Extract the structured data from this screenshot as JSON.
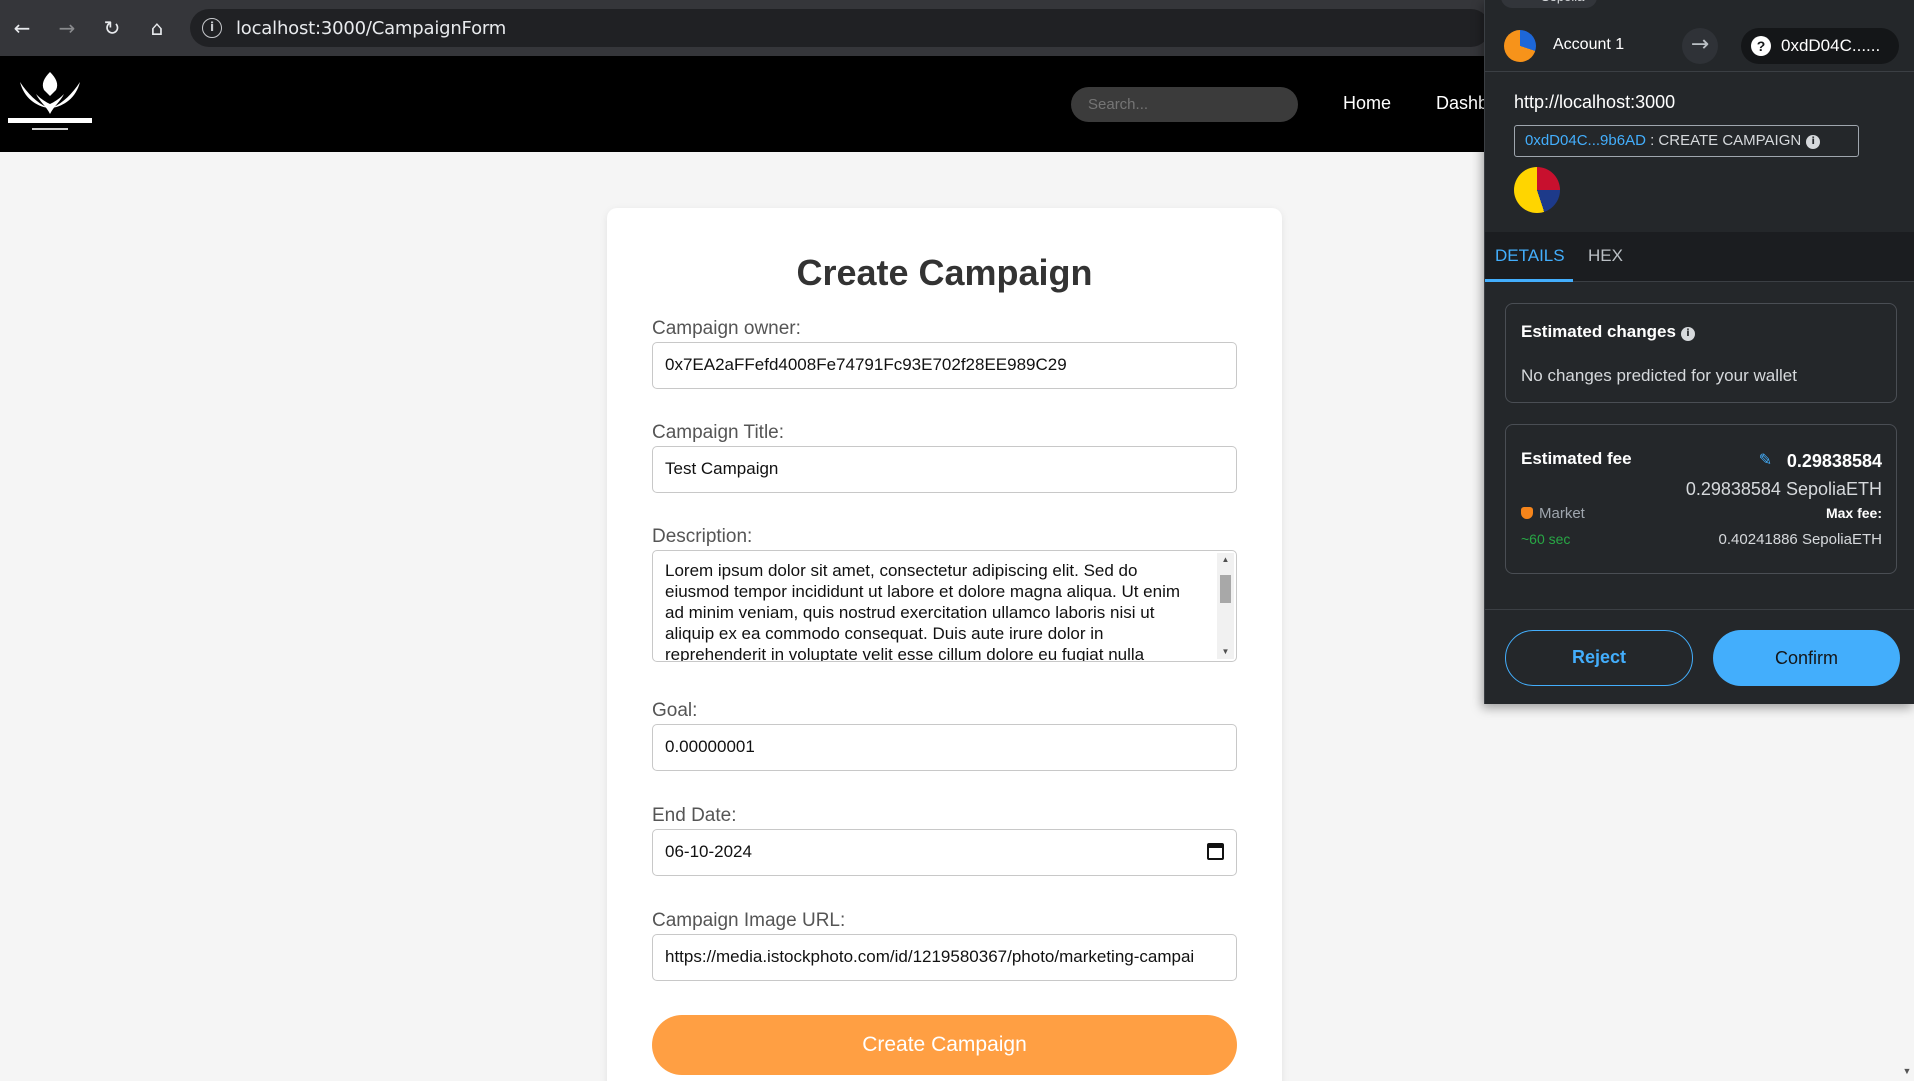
{
  "browser": {
    "url": "localhost:3000/CampaignForm",
    "back_icon": "arrow-left-icon",
    "forward_icon": "arrow-right-icon",
    "reload_icon": "reload-icon",
    "home_icon": "home-icon"
  },
  "site": {
    "logo_icon": "crowdfunding-logo-icon",
    "search_placeholder": "Search...",
    "nav": [
      "Home",
      "Dashb"
    ]
  },
  "form": {
    "title": "Create Campaign",
    "owner_label": "Campaign owner:",
    "owner_value": "0x7EA2aFFefd4008Fe74791Fc93E702f28EE989C29",
    "title_label": "Campaign Title:",
    "title_value": "Test Campaign",
    "description_label": "Description:",
    "description_value": "Lorem ipsum dolor sit amet, consectetur adipiscing elit. Sed do eiusmod tempor incididunt ut labore et dolore magna aliqua. Ut enim ad minim veniam, quis nostrud exercitation ullamco laboris nisi ut aliquip ex ea commodo consequat. Duis aute irure dolor in reprehenderit in voluptate velit esse cillum dolore eu fugiat nulla",
    "goal_label": "Goal:",
    "goal_value": "0.00000001",
    "end_date_label": "End Date:",
    "end_date_value": "06-10-2024",
    "image_label": "Campaign Image URL:",
    "image_value": "https://media.istockphoto.com/id/1219580367/photo/marketing-campai",
    "submit_label": "Create Campaign",
    "accent_color": "#ff9f43"
  },
  "metamask": {
    "network": "Sepolia",
    "account_name": "Account 1",
    "destination": "0xdD04C......",
    "origin": "http://localhost:3000",
    "contract_address": "0xdD04C...9b6AD",
    "separator": " : ",
    "method": "CREATE CAMPAIGN",
    "tabs": [
      "DETAILS",
      "HEX"
    ],
    "active_tab": "DETAILS",
    "estimated_changes_title": "Estimated changes",
    "estimated_changes_text": "No changes predicted for your wallet",
    "estimated_fee_title": "Estimated fee",
    "fee_amount": "0.29838584",
    "fee_eth": "0.29838584 SepoliaETH",
    "market_label": "Market",
    "time_estimate": "~60 sec",
    "max_fee_label": "Max fee:",
    "max_fee_value": "0.40241886 SepoliaETH",
    "reject_label": "Reject",
    "confirm_label": "Confirm",
    "accent_color": "#43aefc"
  }
}
